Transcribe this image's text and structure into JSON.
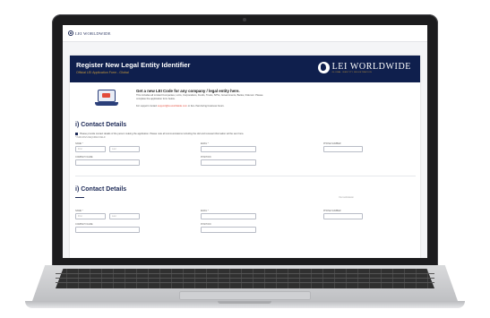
{
  "site": {
    "logo_small": "LEI WORLDWIDE"
  },
  "hero": {
    "title": "Register New Legal Entity Identifier",
    "subtitle": "Official LEI Application Form - Global",
    "logo_text": "LEI WORLDWIDE",
    "logo_tag": "GLOBAL IDENTITY REGISTRATION"
  },
  "intro": {
    "title": "Get a new LEI Code for any company / legal entity here.",
    "text": "This includes all Limited Companies, LLCs, Corporations, Funds, Trusts, SPVs, Governments, Banks, Fidei etc. Please complete the application form below.",
    "support_prefix": "For support contact",
    "support_link": "support@lei-worldwide.com",
    "support_suffix": "or live chat during business hours."
  },
  "section1": {
    "title": "i) Contact Details",
    "subtitle": "Please provide contact details of the person making the application. Please note all communications including the LEI and renewal information will be sent here.",
    "required_note": "* INDICATES REQUIRED FIELD",
    "name_label": "NAME *",
    "first_placeholder": "First",
    "last_placeholder": "Last",
    "email_label": "EMAIL *",
    "phone_label": "PHONE NUMBER",
    "company_label": "COMPANY NAME",
    "position_label": "POSITION"
  },
  "section2": {
    "title": "i) Contact Details",
    "right_note": "Your submission",
    "name_label": "NAME *",
    "first_placeholder": "First",
    "last_placeholder": "Last",
    "email_label": "EMAIL *",
    "phone_label": "PHONE NUMBER",
    "company_label": "COMPANY NAME",
    "position_label": "POSITION"
  },
  "colors": {
    "navy": "#0f1f4d",
    "gold": "#c89b3c",
    "accent_red": "#e24b3b"
  }
}
